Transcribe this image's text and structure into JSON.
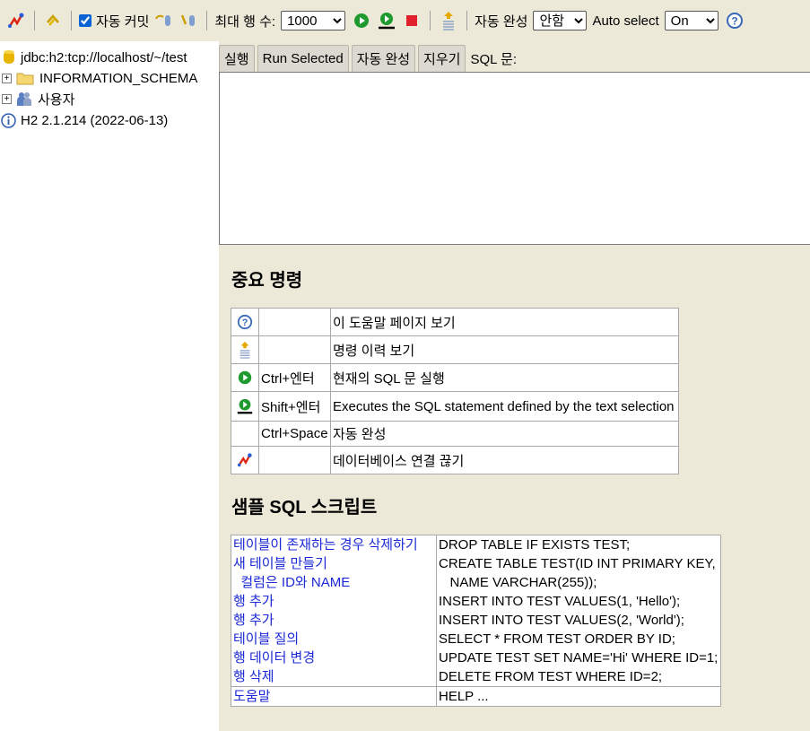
{
  "toolbar": {
    "autocommit_label": "자동 커밋",
    "autocommit_checked": true,
    "maxrows_label": "최대 행 수:",
    "maxrows_value": "1000",
    "autocomplete_label": "자동 완성",
    "autocomplete_value": "안함",
    "autoselect_label": "Auto select",
    "autoselect_value": "On",
    "icons": [
      "disconnect-icon",
      "refresh-icon",
      "rollback-icon",
      "commit-icon",
      "run-icon",
      "run-selected-icon",
      "stop-icon",
      "history-icon",
      "help-icon"
    ]
  },
  "tree": {
    "connection": "jdbc:h2:tcp://localhost/~/test",
    "schema": "INFORMATION_SCHEMA",
    "users": "사용자",
    "version": "H2 2.1.214 (2022-06-13)"
  },
  "editor": {
    "run_label": "실행",
    "run_selected_label": "Run Selected",
    "autocomplete_label": "자동 완성",
    "clear_label": "지우기",
    "sql_label": "SQL 문:"
  },
  "important": {
    "title": "중요 명령",
    "rows": [
      {
        "icon": "help-icon",
        "keys": "",
        "desc": "이 도움말 페이지 보기"
      },
      {
        "icon": "history-icon",
        "keys": "",
        "desc": "명령 이력 보기"
      },
      {
        "icon": "run-icon",
        "keys": "Ctrl+엔터",
        "desc": "현재의 SQL 문 실행"
      },
      {
        "icon": "run-selected-icon",
        "keys": "Shift+엔터",
        "desc": "Executes the SQL statement defined by the text selection"
      },
      {
        "icon": "",
        "keys": "Ctrl+Space",
        "desc": "자동 완성"
      },
      {
        "icon": "disconnect-icon",
        "keys": "",
        "desc": "데이터베이스 연결 끊기"
      }
    ]
  },
  "samples": {
    "title": "샘플 SQL 스크립트",
    "links": [
      "테이블이 존재하는 경우 삭제하기",
      "새 테이블 만들기",
      "  컬럼은 ID와 NAME",
      "행 추가",
      "행 추가",
      "테이블 질의",
      "행 데이터 변경",
      "행 삭제"
    ],
    "code": [
      "DROP TABLE IF EXISTS TEST;",
      "CREATE TABLE TEST(ID INT PRIMARY KEY,",
      "   NAME VARCHAR(255));",
      "INSERT INTO TEST VALUES(1, 'Hello');",
      "INSERT INTO TEST VALUES(2, 'World');",
      "SELECT * FROM TEST ORDER BY ID;",
      "UPDATE TEST SET NAME='Hi' WHERE ID=1;",
      "DELETE FROM TEST WHERE ID=2;"
    ],
    "help_link": "도움말",
    "help_code": "HELP ..."
  }
}
